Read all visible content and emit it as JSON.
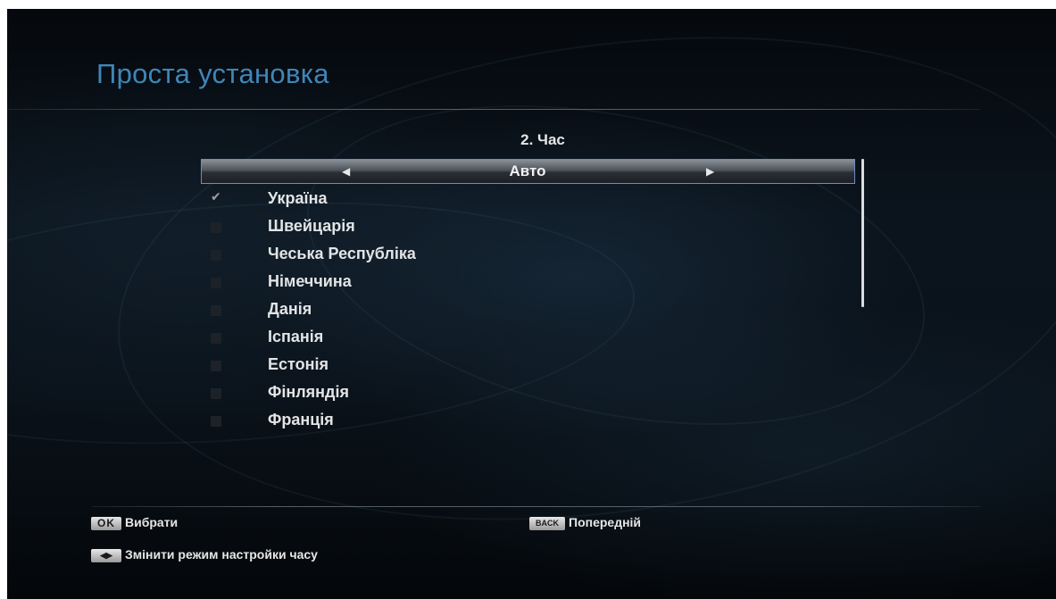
{
  "header": {
    "title": "Проста установка"
  },
  "wizard": {
    "step_label": "2. Час",
    "mode_selector": {
      "value": "Авто",
      "left_arrow_icon": "arrow-left-icon",
      "right_arrow_icon": "arrow-right-icon"
    },
    "countries": [
      {
        "label": "Україна",
        "checked": true
      },
      {
        "label": "Швейцарія",
        "checked": false
      },
      {
        "label": "Чеська Республіка",
        "checked": false
      },
      {
        "label": "Німеччина",
        "checked": false
      },
      {
        "label": "Данія",
        "checked": false
      },
      {
        "label": "Іспанія",
        "checked": false
      },
      {
        "label": "Естонія",
        "checked": false
      },
      {
        "label": "Фінляндія",
        "checked": false
      },
      {
        "label": "Франція",
        "checked": false
      }
    ]
  },
  "footer": {
    "ok_key": "OK",
    "ok_label": "Вибрати",
    "back_key": "BACK",
    "back_label": "Попередній",
    "lr_key_icon": "left-right-keys-icon",
    "lr_label": "Змінити режим настройки часу"
  },
  "colors": {
    "title": "#3f86b8",
    "background": "#0a121a",
    "selector_border": "#6c8fb8"
  }
}
